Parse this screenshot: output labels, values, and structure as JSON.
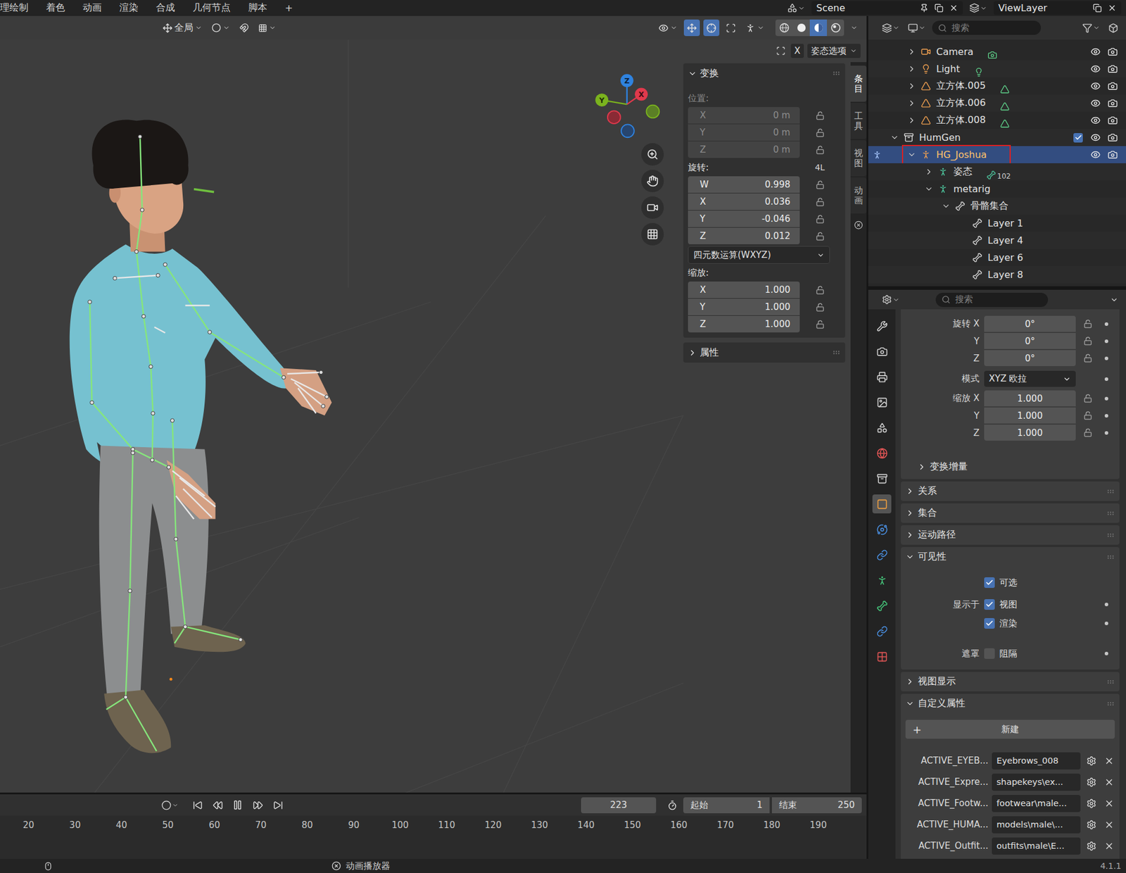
{
  "top_bar": {
    "workspaces": [
      {
        "label": "理绘制",
        "selected": false
      },
      {
        "label": "着色",
        "selected": false
      },
      {
        "label": "动画",
        "selected": false
      },
      {
        "label": "渲染",
        "selected": false
      },
      {
        "label": "合成",
        "selected": false
      },
      {
        "label": "几何节点",
        "selected": false
      },
      {
        "label": "脚本",
        "selected": false
      }
    ],
    "add": "+",
    "scene": "Scene",
    "view_layer": "ViewLayer"
  },
  "viewport": {
    "orientation": "全局",
    "toggles": [
      {
        "kind": "gizmo",
        "on": true
      },
      {
        "kind": "overlay",
        "on": true
      },
      {
        "kind": "xray",
        "on": false
      }
    ],
    "shading": [
      {
        "kind": "wireframe",
        "selected": false
      },
      {
        "kind": "solid",
        "selected": false
      },
      {
        "kind": "material",
        "selected": true
      },
      {
        "kind": "rendered",
        "selected": false
      }
    ],
    "gizmo": {
      "x": "X",
      "y": "Y",
      "z": "Z"
    },
    "tool_options": {
      "axis": "X",
      "menu": "姿态选项"
    }
  },
  "sidebar": {
    "tabs": [
      {
        "label": "条目",
        "selected": true
      },
      {
        "label": "工具",
        "selected": false
      },
      {
        "label": "视图",
        "selected": false
      },
      {
        "label": "动画",
        "selected": false
      }
    ],
    "transform": {
      "title": "变换",
      "expanded": true,
      "groups": [
        {
          "label": "位置:",
          "badge": "",
          "disabled": true,
          "mode": "",
          "fields": [
            {
              "axis": "X",
              "value": "0 m",
              "locked": false
            },
            {
              "axis": "Y",
              "value": "0 m",
              "locked": false
            },
            {
              "axis": "Z",
              "value": "0 m",
              "locked": false
            }
          ]
        },
        {
          "label": "旋转:",
          "badge": "4L",
          "disabled": false,
          "mode": "四元数运算(WXYZ)",
          "fields": [
            {
              "axis": "W",
              "value": "0.998",
              "locked": false
            },
            {
              "axis": "X",
              "value": "0.036",
              "locked": false
            },
            {
              "axis": "Y",
              "value": "-0.046",
              "locked": false
            },
            {
              "axis": "Z",
              "value": "0.012",
              "locked": false
            }
          ]
        },
        {
          "label": "缩放:",
          "badge": "",
          "disabled": false,
          "mode": "",
          "fields": [
            {
              "axis": "X",
              "value": "1.000",
              "locked": false
            },
            {
              "axis": "Y",
              "value": "1.000",
              "locked": false
            },
            {
              "axis": "Z",
              "value": "1.000",
              "locked": false
            }
          ]
        }
      ]
    },
    "attributes": {
      "title": "属性",
      "expanded": false
    }
  },
  "outliner": {
    "search": "搜索",
    "rows": [
      {
        "label": "Camera",
        "kind": "camera",
        "level": 1,
        "expandable": true,
        "expanded": false,
        "selected": false,
        "visible": true,
        "included": false,
        "badge": "",
        "annotated": false
      },
      {
        "label": "Light",
        "kind": "light",
        "level": 1,
        "expandable": true,
        "expanded": false,
        "selected": false,
        "visible": true,
        "included": false,
        "badge": "",
        "annotated": false
      },
      {
        "label": "立方体.005",
        "kind": "mesh",
        "level": 1,
        "expandable": true,
        "expanded": false,
        "selected": false,
        "visible": true,
        "included": false,
        "badge": "",
        "annotated": false
      },
      {
        "label": "立方体.006",
        "kind": "mesh",
        "level": 1,
        "expandable": true,
        "expanded": false,
        "selected": false,
        "visible": true,
        "included": false,
        "badge": "",
        "annotated": false
      },
      {
        "label": "立方体.008",
        "kind": "mesh",
        "level": 1,
        "expandable": true,
        "expanded": false,
        "selected": false,
        "visible": true,
        "included": false,
        "badge": "",
        "annotated": false
      },
      {
        "label": "HumGen",
        "kind": "collection",
        "level": 0,
        "expandable": true,
        "expanded": true,
        "selected": false,
        "visible": true,
        "included": true,
        "badge": "",
        "annotated": false
      },
      {
        "label": "HG_Joshua",
        "kind": "armature",
        "level": 1,
        "expandable": true,
        "expanded": true,
        "selected": true,
        "visible": true,
        "included": false,
        "badge": "",
        "annotated": true
      },
      {
        "label": "姿态",
        "kind": "pose",
        "level": 2,
        "expandable": true,
        "expanded": false,
        "selected": false,
        "visible": false,
        "included": false,
        "badge": "102",
        "annotated": false
      },
      {
        "label": "metarig",
        "kind": "armature_data",
        "level": 2,
        "expandable": true,
        "expanded": true,
        "selected": false,
        "visible": false,
        "included": false,
        "badge": "",
        "annotated": false
      },
      {
        "label": "骨骼集合",
        "kind": "bone_collections",
        "level": 3,
        "expandable": true,
        "expanded": true,
        "selected": false,
        "visible": false,
        "included": false,
        "badge": "",
        "annotated": false
      },
      {
        "label": "Layer 1",
        "kind": "bone_layer",
        "level": 4,
        "expandable": false,
        "expanded": false,
        "selected": false,
        "visible": false,
        "included": false,
        "badge": "",
        "annotated": false
      },
      {
        "label": "Layer 4",
        "kind": "bone_layer",
        "level": 4,
        "expandable": false,
        "expanded": false,
        "selected": false,
        "visible": false,
        "included": false,
        "badge": "",
        "annotated": false
      },
      {
        "label": "Layer 6",
        "kind": "bone_layer",
        "level": 4,
        "expandable": false,
        "expanded": false,
        "selected": false,
        "visible": false,
        "included": false,
        "badge": "",
        "annotated": false
      },
      {
        "label": "Layer 8",
        "kind": "bone_layer",
        "level": 4,
        "expandable": false,
        "expanded": false,
        "selected": false,
        "visible": false,
        "included": false,
        "badge": "",
        "annotated": false
      }
    ]
  },
  "properties": {
    "search": "搜索",
    "tabs": [
      {
        "kind": "tool",
        "selected": false
      },
      {
        "kind": "render",
        "selected": false
      },
      {
        "kind": "output",
        "selected": false
      },
      {
        "kind": "view_layer",
        "selected": false
      },
      {
        "kind": "scene",
        "selected": false
      },
      {
        "kind": "world",
        "selected": false
      },
      {
        "kind": "collection",
        "selected": false
      },
      {
        "kind": "object",
        "selected": true
      },
      {
        "kind": "physics",
        "selected": false
      },
      {
        "kind": "object_constraints",
        "selected": false
      },
      {
        "kind": "armature_data",
        "selected": false
      },
      {
        "kind": "bone",
        "selected": false
      },
      {
        "kind": "bone_constraints",
        "selected": false
      },
      {
        "kind": "texture",
        "selected": false
      }
    ],
    "transform": {
      "rotation": [
        {
          "label": "旋转 X",
          "value": "0°",
          "locked": false
        },
        {
          "label": "Y",
          "value": "0°",
          "locked": false
        },
        {
          "label": "Z",
          "value": "0°",
          "locked": false
        }
      ],
      "mode": {
        "label": "模式",
        "value": "XYZ 欧拉"
      },
      "scale": [
        {
          "label": "缩放 X",
          "value": "1.000",
          "locked": false
        },
        {
          "label": "Y",
          "value": "1.000",
          "locked": false
        },
        {
          "label": "Z",
          "value": "1.000",
          "locked": false
        }
      ],
      "delta": {
        "label": "变换增量",
        "expanded": false
      }
    },
    "panels_before": [
      {
        "label": "关系",
        "expanded": false
      },
      {
        "label": "集合",
        "expanded": false
      },
      {
        "label": "运动路径",
        "expanded": false
      }
    ],
    "visibility": {
      "label": "可见性",
      "expanded": true,
      "selectable": {
        "label": "可选",
        "checked": true
      },
      "show_in": {
        "label": "显示于",
        "options": [
          {
            "label": "视图",
            "checked": true
          },
          {
            "label": "渲染",
            "checked": true
          }
        ]
      },
      "mask": {
        "label": "遮罩",
        "options": [
          {
            "label": "阻隔",
            "checked": false
          }
        ]
      }
    },
    "viewport_display": {
      "label": "视图显示",
      "expanded": false
    },
    "custom_properties": {
      "label": "自定义属性",
      "expanded": true,
      "add": {
        "icon": "+",
        "label": "新建"
      },
      "items": [
        {
          "key": "ACTIVE_EYEB...",
          "value": "Eyebrows_008"
        },
        {
          "key": "ACTIVE_Expre...",
          "value": "shapekeys\\ex..."
        },
        {
          "key": "ACTIVE_Footw...",
          "value": "footwear\\male..."
        },
        {
          "key": "ACTIVE_HUMA...",
          "value": "models\\male\\..."
        },
        {
          "key": "ACTIVE_Outfit...",
          "value": "outfits\\male\\E..."
        }
      ]
    }
  },
  "timeline": {
    "playing": true,
    "frame": "223",
    "start": {
      "label": "起始",
      "value": "1"
    },
    "end": {
      "label": "结束",
      "value": "250"
    },
    "ticks": [
      "20",
      "30",
      "40",
      "50",
      "60",
      "70",
      "80",
      "90",
      "100",
      "110",
      "120",
      "130",
      "140",
      "150",
      "160",
      "170",
      "180",
      "190"
    ]
  },
  "status_bar": {
    "action": "动画播放器",
    "version": "4.1.1"
  }
}
